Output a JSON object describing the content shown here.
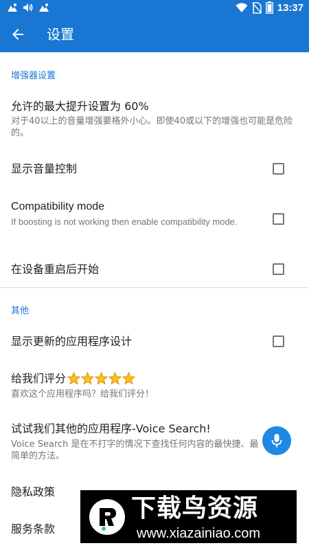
{
  "status_bar": {
    "time": "13:37",
    "left_icons": [
      "mountain-icon",
      "volume-icon",
      "mountain-icon"
    ],
    "right_icons": [
      "wifi-icon",
      "no-sim-icon",
      "battery-icon"
    ]
  },
  "app_bar": {
    "title": "设置",
    "back_icon": "arrow-back-icon",
    "color": "#1976d2"
  },
  "sections": {
    "booster": {
      "header": "增强器设置",
      "max_boost": {
        "title": "允许的最大提升设置为 60%",
        "summary": "对于40以上的音量增强要格外小心。即使40或以下的增强也可能是危险的。"
      },
      "show_volume_control": {
        "title": "显示音量控制",
        "checked": false
      },
      "compatibility_mode": {
        "title": "Compatibility mode",
        "summary": "If boosting is not working then enable compatibility mode.",
        "checked": false
      },
      "start_on_boot": {
        "title": "在设备重启后开始",
        "checked": false
      }
    },
    "other": {
      "header": "其他",
      "show_updated_design": {
        "title": "显示更新的应用程序设计",
        "checked": false
      },
      "rate_us": {
        "title": "给我们评分",
        "star_count": 5,
        "star_icon": "star-icon",
        "summary": "喜欢这个应用程序吗？给我们评分！"
      },
      "voice_search": {
        "title": "试试我们其他的应用程序-Voice Search!",
        "summary": "Voice Search 是在不打字的情况下查找任何内容的最快捷、最简单的方法。",
        "icon": "microphone-icon"
      },
      "privacy_policy": {
        "title": "隐私政策"
      },
      "terms": {
        "title": "服务条款"
      }
    }
  },
  "watermark": {
    "title": "下载鸟资源",
    "url": "www.xiazainiao.com"
  }
}
